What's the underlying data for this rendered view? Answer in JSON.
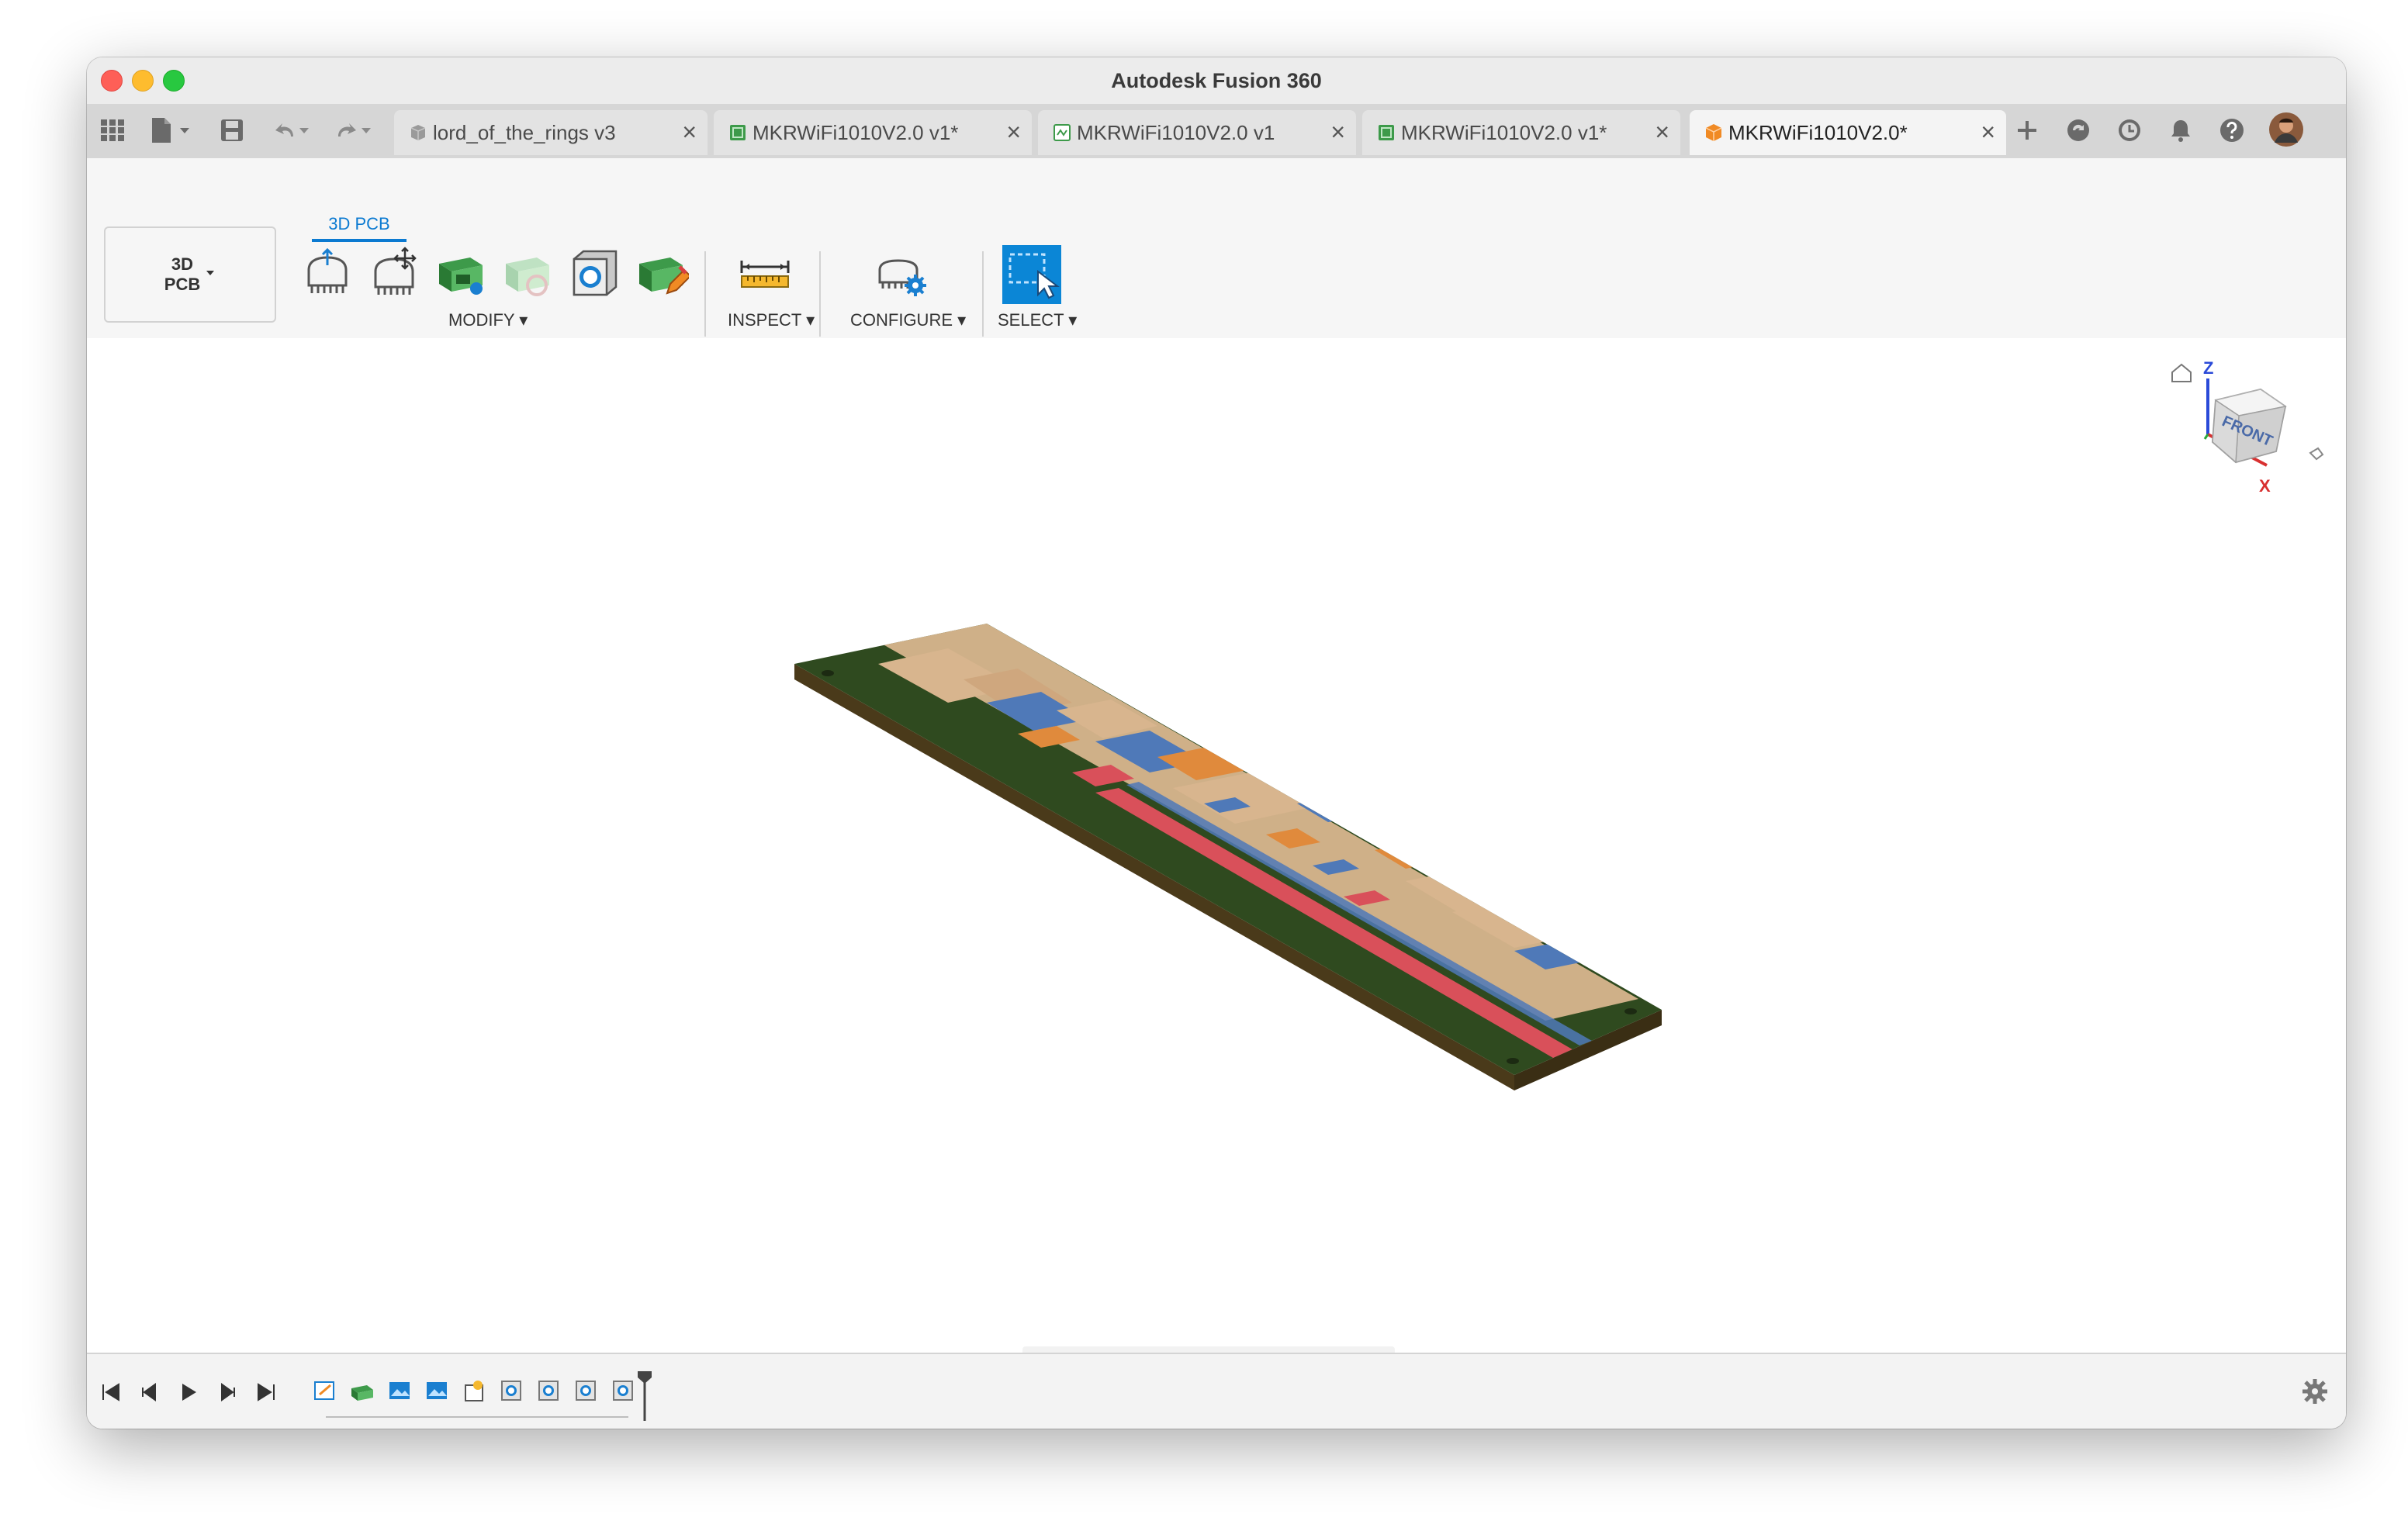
{
  "window": {
    "title": "Autodesk Fusion 360"
  },
  "tabs": [
    {
      "label": "lord_of_the_rings v3",
      "icon": "component-icon",
      "active": false
    },
    {
      "label": "MKRWiFi1010V2.0 v1*",
      "icon": "pcb-icon",
      "active": false
    },
    {
      "label": "MKRWiFi1010V2.0 v1",
      "icon": "schematic-icon",
      "active": false
    },
    {
      "label": "MKRWiFi1010V2.0 v1*",
      "icon": "pcb-icon",
      "active": false
    },
    {
      "label": "MKRWiFi1010V2.0*",
      "icon": "design-box-icon",
      "active": true
    }
  ],
  "toolbar": {
    "workspace_line1": "3D",
    "workspace_line2": "PCB",
    "active_tab": "3D PCB",
    "groups": {
      "modify": "MODIFY",
      "inspect": "INSPECT",
      "configure": "CONFIGURE",
      "select": "SELECT"
    }
  },
  "viewcube": {
    "face_label": "FRONT",
    "axis_z": "Z",
    "axis_x": "X"
  },
  "colors": {
    "accent": "#0b7ad1",
    "board_green": "#2f4a1f",
    "pad_copper": "#d8b58e",
    "red_trace": "#d9505a",
    "blue_pad": "#4f79b8",
    "orange_pad": "#e08a3c"
  }
}
